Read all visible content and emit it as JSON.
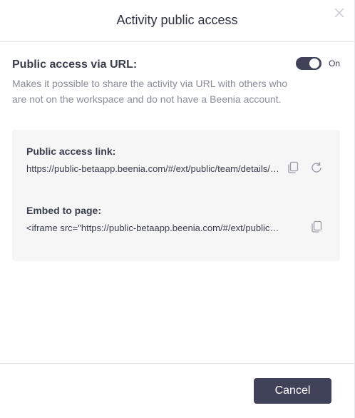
{
  "dialog": {
    "title": "Activity public access",
    "close_icon": "close-icon"
  },
  "public_access": {
    "title": "Public access via URL:",
    "description": "Makes it possible to share the activity via URL with others who are not on the workspace and do not have a Beenia account.",
    "toggle_state": "On",
    "toggle_on": true
  },
  "panel": {
    "link_label": "Public access link:",
    "link_value": "https://public-betaapp.beenia.com/#/ext/public/team/details/activity",
    "link_copy_icon": "copy-icon",
    "link_refresh_icon": "refresh-icon",
    "embed_label": "Embed to page:",
    "embed_value": "<iframe src=\"https://public-betaapp.beenia.com/#/ext/public/team/details/activity\"></iframe>",
    "embed_copy_icon": "copy-icon"
  },
  "footer": {
    "cancel_label": "Cancel"
  },
  "colors": {
    "primary": "#3f4259",
    "panel_bg": "#f6f6f7",
    "muted_text": "#8a8d99"
  }
}
